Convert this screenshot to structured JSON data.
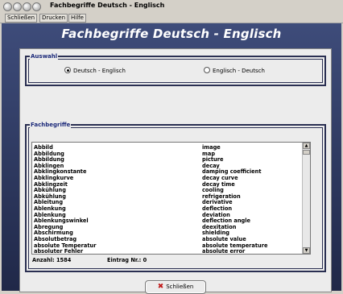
{
  "window": {
    "title": "Fachbegriffe Deutsch - Englisch"
  },
  "menu": {
    "items": [
      "Schließen",
      "Drucken",
      "Hilfe"
    ]
  },
  "header": {
    "title": "Fachbegriffe Deutsch - Englisch"
  },
  "auswahl": {
    "label": "Auswahl",
    "options": [
      {
        "label": "Deutsch - Englisch",
        "selected": true
      },
      {
        "label": "Englisch - Deutsch",
        "selected": false
      }
    ]
  },
  "fachbegriffe": {
    "label": "Fachbegriffe",
    "rows": [
      [
        "Abbild",
        "image"
      ],
      [
        "Abbildung",
        "map"
      ],
      [
        "Abbildung",
        "picture"
      ],
      [
        "Abklingen",
        "decay"
      ],
      [
        "Abklingkonstante",
        "damping coefficient"
      ],
      [
        "Abklingkurve",
        "decay curve"
      ],
      [
        "Abklingzeit",
        "decay time"
      ],
      [
        "Abkühlung",
        "cooling"
      ],
      [
        "Abkühlung",
        "refrigeration"
      ],
      [
        "Ableitung",
        "derivative"
      ],
      [
        "Ablenkung",
        "deflection"
      ],
      [
        "Ablenkung",
        "deviation"
      ],
      [
        "Ablenkungswinkel",
        "deflection angle"
      ],
      [
        "Abregung",
        "deexitation"
      ],
      [
        "Abschirmung",
        "shielding"
      ],
      [
        "Absolutbetrag",
        "absolute value"
      ],
      [
        "absolute Temperatur",
        "absolute temperature"
      ],
      [
        "absoluter Fehler",
        "absolute error"
      ]
    ],
    "count_label": "Anzahl: 1584",
    "entry_label": "Eintrag Nr.: 0"
  },
  "close_button": {
    "label": "Schließen"
  },
  "icons": {
    "close": "close-x-icon"
  },
  "colors": {
    "header_bg": "#3e4c7a",
    "group_label": "#1c2a7a",
    "close_icon": "#c01818"
  }
}
